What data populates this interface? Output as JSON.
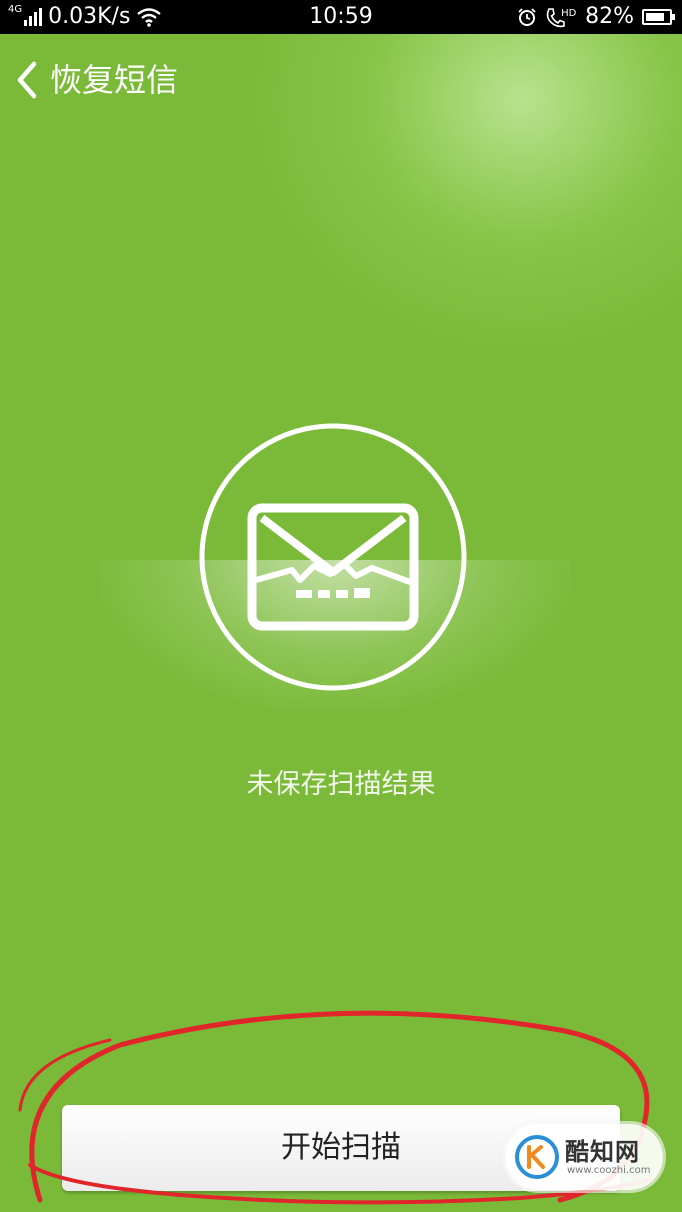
{
  "status_bar": {
    "network_type": "4G",
    "speed": "0.03K/s",
    "time": "10:59",
    "call_badge": "HD",
    "battery_percent": "82%",
    "battery_level": 0.82
  },
  "header": {
    "title": "恢复短信"
  },
  "main": {
    "status_text": "未保存扫描结果"
  },
  "actions": {
    "start_scan_label": "开始扫描"
  },
  "watermark": {
    "title": "酷知网",
    "url": "www.coozhi.com"
  },
  "colors": {
    "background": "#7aba38",
    "annotation": "#e0262b"
  }
}
